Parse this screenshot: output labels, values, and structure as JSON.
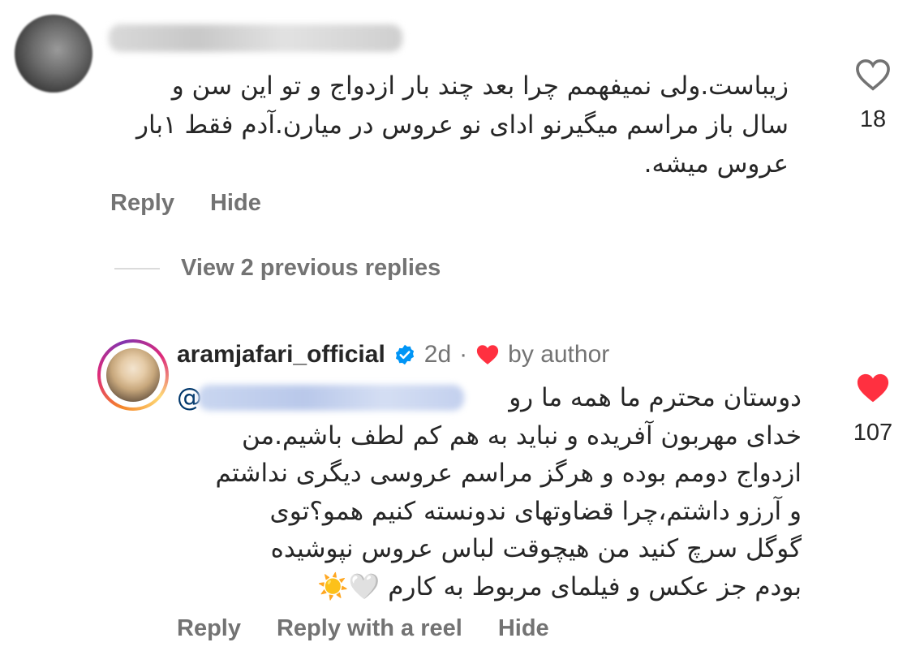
{
  "comment1": {
    "body_lines": [
      "زیباست.ولی نمیفهمم چرا بعد چند بار ازدواج و تو این سن و",
      "سال باز مراسم میگیرنو ادای نو عروس در میارن.آدم فقط ۱بار",
      "عروس میشه."
    ],
    "like_count": "18",
    "icon": "heart-outline-icon",
    "actions": {
      "reply": "Reply",
      "hide": "Hide"
    }
  },
  "replies_divider": {
    "label": "View 2 previous replies"
  },
  "comment2": {
    "username": "aramjafari_official",
    "time": "2d",
    "separator": "·",
    "liked_by_author": "by author",
    "mention_prefix": "@",
    "body_first_line": "دوستان محترم ما همه ما رو",
    "body_lines": [
      "خدای مهربون آفریده و نباید به هم کم لطف باشیم.من",
      "ازدواج دومم بوده و هرگز مراسم عروسی دیگری نداشتم",
      "و آرزو داشتم،چرا قضاوتهای ندونسته کنیم همو؟توی",
      "گوگل سرچ کنید من هیچوقت لباس عروس نپوشیده",
      "بودم جز عکس و فیلمای مربوط به کارم 🤍☀️"
    ],
    "like_count": "107",
    "icon": "heart-filled-icon",
    "actions": {
      "reply": "Reply",
      "reply_reel": "Reply with a reel",
      "hide": "Hide"
    }
  },
  "colors": {
    "like_red": "#ff3040",
    "verified_blue": "#0095f6",
    "muted_text": "#737373"
  }
}
